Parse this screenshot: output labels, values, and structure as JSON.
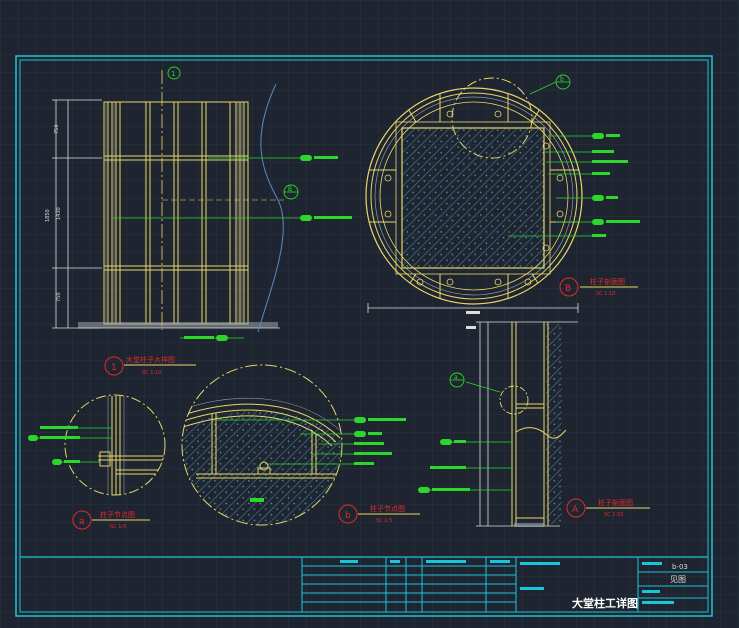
{
  "drawing": {
    "sheet_title": "大堂柱工详图",
    "sheet_number": "b-03",
    "sheet_subtitle": "见图",
    "views": {
      "elevation": {
        "number": "1",
        "title": "大堂柱子大样图",
        "scale": "SC 1:10"
      },
      "section_plan": {
        "number": "B",
        "title": "柱子剖面图",
        "scale": "SC 1:10"
      },
      "section_side": {
        "number": "A",
        "title": "柱子剖面图",
        "scale": "SC 1:10"
      },
      "node_a": {
        "number": "a",
        "title": "柱子节点图",
        "scale": "SC 1:5"
      },
      "node_b": {
        "number": "b",
        "title": "柱子节点图",
        "scale": "SC 1:5"
      }
    },
    "markers": {
      "elevation_top": "1",
      "elevation_cut": "B",
      "plan_detail": "b",
      "side_detail": "a"
    }
  },
  "colors": {
    "background": "#1f2530",
    "grid": "#2a323e",
    "frame": "#19c5d8",
    "structure": "#e8d66a",
    "leader": "#2ad72a",
    "marker": "#e02b2b",
    "dimension": "#dcdcdc",
    "hatch": "#3f7f95",
    "dashed_circle": "#e8d66a"
  }
}
